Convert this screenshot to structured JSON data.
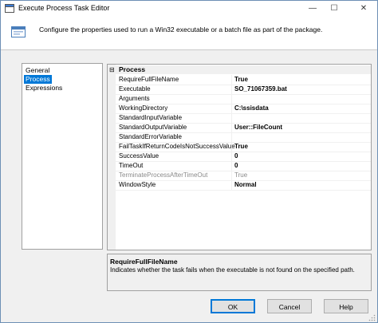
{
  "window": {
    "title": "Execute Process Task Editor",
    "controls": {
      "minimize": "—",
      "maximize": "☐",
      "close": "✕"
    }
  },
  "banner": {
    "description": "Configure the properties used to run a Win32 executable or a batch file as part of the package.",
    "icon": "task-icon"
  },
  "nav": {
    "items": [
      {
        "label": "General",
        "selected": false
      },
      {
        "label": "Process",
        "selected": true
      },
      {
        "label": "Expressions",
        "selected": false
      }
    ]
  },
  "grid": {
    "category": "Process",
    "toggle": "⊟",
    "properties": [
      {
        "name": "RequireFullFileName",
        "value": "True",
        "bold": true
      },
      {
        "name": "Executable",
        "value": "SO_71067359.bat",
        "bold": true
      },
      {
        "name": "Arguments",
        "value": "",
        "bold": false
      },
      {
        "name": "WorkingDirectory",
        "value": "C:\\ssisdata",
        "bold": true
      },
      {
        "name": "StandardInputVariable",
        "value": "",
        "bold": false
      },
      {
        "name": "StandardOutputVariable",
        "value": "User::FileCount",
        "bold": true
      },
      {
        "name": "StandardErrorVariable",
        "value": "",
        "bold": false
      },
      {
        "name": "FailTaskIfReturnCodeIsNotSuccessValue",
        "value": "True",
        "bold": true
      },
      {
        "name": "SuccessValue",
        "value": "0",
        "bold": true
      },
      {
        "name": "TimeOut",
        "value": "0",
        "bold": true
      },
      {
        "name": "TerminateProcessAfterTimeOut",
        "value": "True",
        "bold": false,
        "disabled": true
      },
      {
        "name": "WindowStyle",
        "value": "Normal",
        "bold": true
      }
    ]
  },
  "help": {
    "title": "RequireFullFileName",
    "text": "Indicates whether the task fails when the executable is not found on the specified path."
  },
  "buttons": {
    "ok": "OK",
    "cancel": "Cancel",
    "help": "Help"
  },
  "colors": {
    "selection": "#0078d7",
    "border": "#a0a0a0"
  }
}
